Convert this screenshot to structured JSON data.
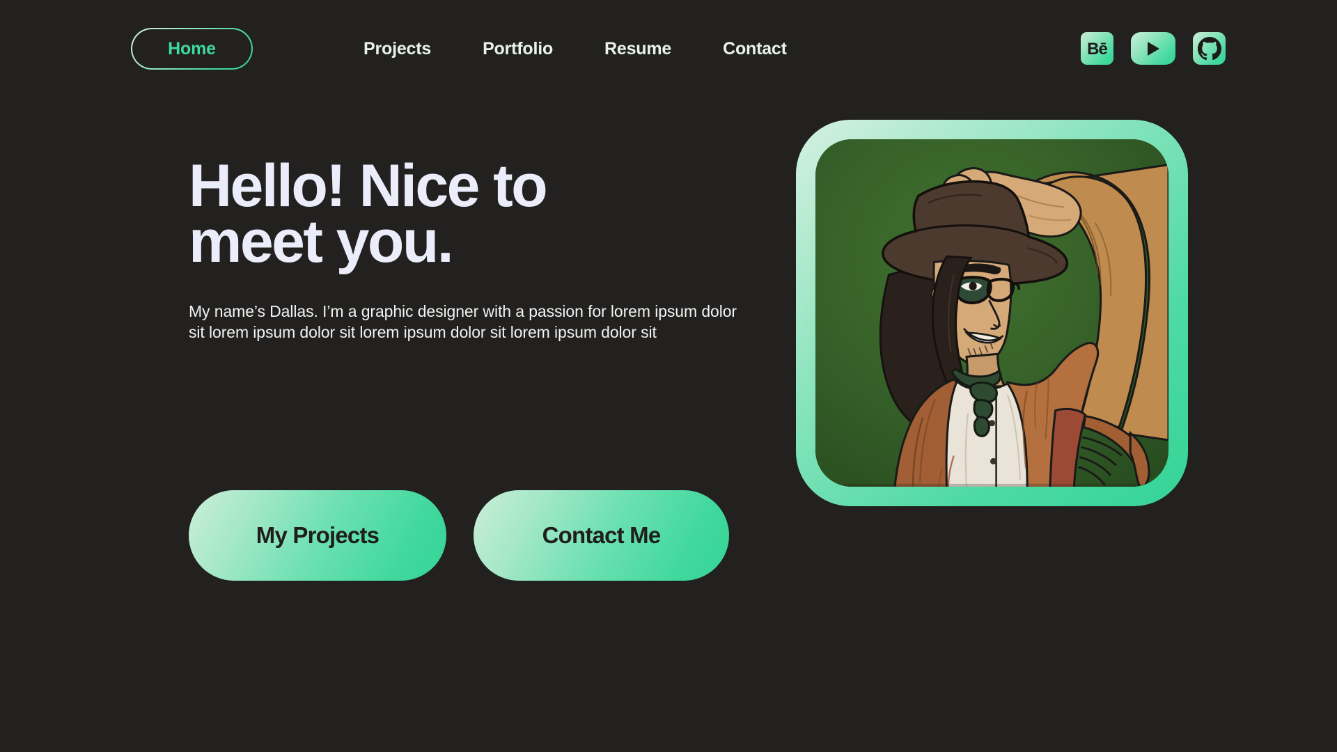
{
  "theme": {
    "background": "#222120",
    "accent_green": "#3ddb9e",
    "accent_pale": "#cdeeda",
    "headline_color": "#ecedfa",
    "body_text_color": "#f2f2f2",
    "button_text_color": "#1f1e1d",
    "art_bg_green": "#35602a"
  },
  "header": {
    "home_label": "Home",
    "nav_items": [
      {
        "label": "Projects"
      },
      {
        "label": "Portfolio"
      },
      {
        "label": "Resume"
      },
      {
        "label": "Contact"
      }
    ],
    "socials": [
      {
        "name": "behance-icon",
        "glyph": "Bē",
        "label": "Behance"
      },
      {
        "name": "youtube-icon",
        "glyph": "▶",
        "label": "YouTube"
      },
      {
        "name": "github-icon",
        "glyph": "",
        "label": "GitHub"
      }
    ]
  },
  "hero": {
    "headline": "Hello! Nice to\nmeet you.",
    "subtext": "My name’s Dallas. I’m a graphic designer with a passion for lorem ipsum dolor sit  lorem ipsum dolor sit  lorem ipsum dolor sit  lorem ipsum dolor sit",
    "cta_primary": "My Projects",
    "cta_secondary": "Contact Me"
  },
  "illustration": {
    "alt": "Illustrated portrait of a long-haired person wearing glasses, a wide-brim brown cowboy hat tipped with one hand, a green neckerchief, white shirt and tan jacket, on a dark green background"
  }
}
